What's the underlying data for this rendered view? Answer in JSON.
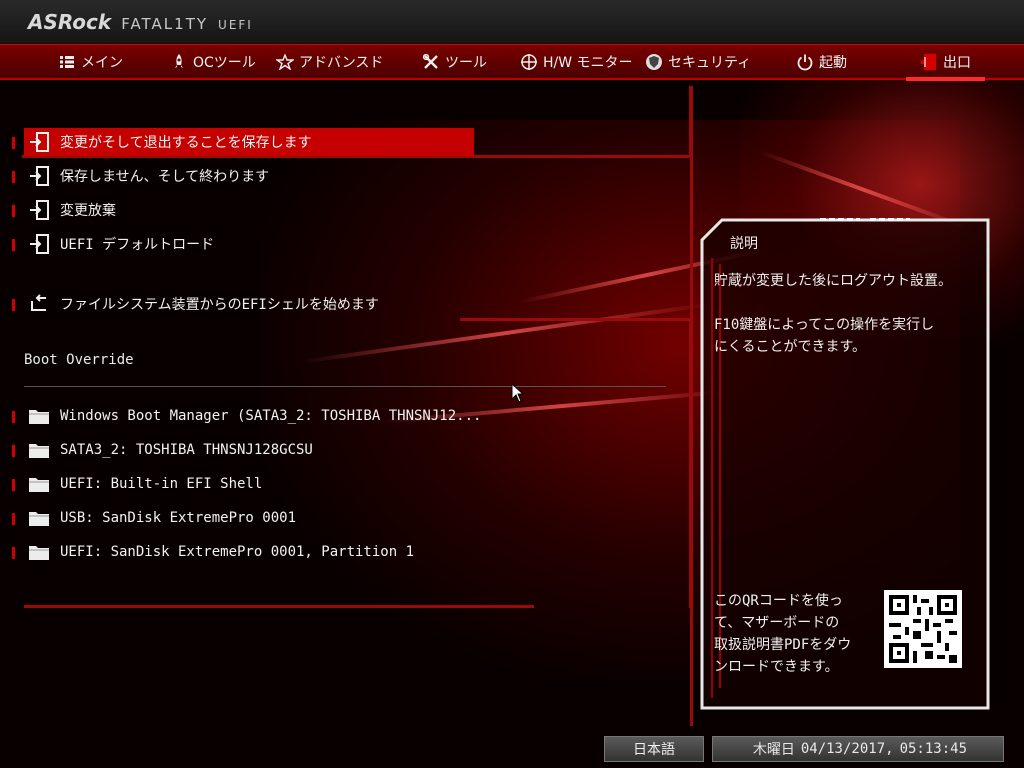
{
  "brand": {
    "maker": "ASRock",
    "line": "FATAL1TY",
    "suffix": "UEFI"
  },
  "nav": [
    {
      "label": "メイン",
      "icon": "list-icon"
    },
    {
      "label": "OCツール",
      "icon": "rocket-icon"
    },
    {
      "label": "アドバンスド",
      "icon": "star-icon"
    },
    {
      "label": "ツール",
      "icon": "tools-icon"
    },
    {
      "label": "H/W モニター",
      "icon": "crosshair-icon"
    },
    {
      "label": "セキュリティ",
      "icon": "shield-icon"
    },
    {
      "label": "起動",
      "icon": "power-icon"
    },
    {
      "label": "出口",
      "icon": "exit-icon",
      "active": true
    }
  ],
  "exit_menu": [
    {
      "label": "変更がそして退出することを保存します",
      "selected": true
    },
    {
      "label": "保存しません、そして終わります"
    },
    {
      "label": "変更放棄"
    },
    {
      "label": "UEFI デフォルトロード"
    },
    {
      "label": "ファイルシステム装置からのEFIシェルを始めます"
    }
  ],
  "boot_override": {
    "title": "Boot Override",
    "items": [
      "Windows Boot Manager (SATA3_2: TOSHIBA THNSNJ12...",
      "SATA3_2: TOSHIBA THNSNJ128GCSU",
      "UEFI: Built-in EFI Shell",
      "USB: SanDisk ExtremePro 0001",
      "UEFI: SanDisk ExtremePro 0001, Partition 1"
    ]
  },
  "description": {
    "title": "説明",
    "text": "貯蔵が変更した後にログアウト設置。\n\nF10鍵盤によってこの操作を実行し\nにくることができます。",
    "qr_text": "このQRコードを使っ\nて、マザーボードの\n取扱説明書PDFをダウ\nンロードできます。"
  },
  "footer": {
    "language": "日本語",
    "weekday": "木曜日",
    "date": "04/13/2017,",
    "time": "05:13:45"
  },
  "colors": {
    "accent": "#c40000",
    "nav_bg": "#5a0000",
    "panel_border": "#e8e8e8"
  }
}
